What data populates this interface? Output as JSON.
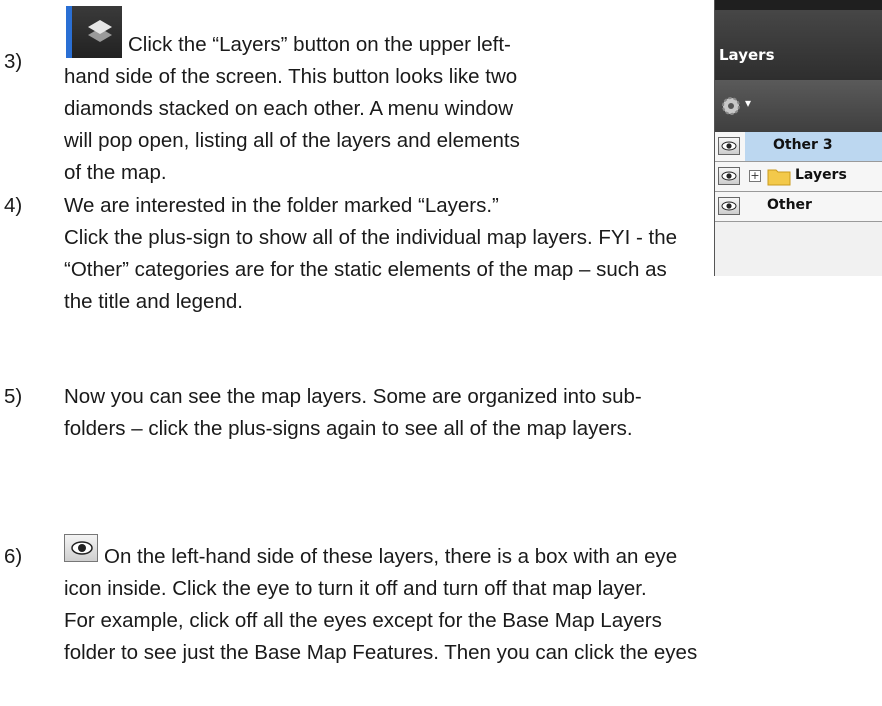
{
  "items": [
    {
      "number": "3)",
      "lines": [
        "Click the “Layers” button on the upper left-",
        "hand side of the screen. This button looks like two",
        "diamonds stacked on each other. A menu window",
        "will pop open, listing all of the layers and elements",
        "of the map."
      ]
    },
    {
      "number": "4)",
      "lines": [
        "We are interested in the folder marked “Layers.”",
        "Click the plus-sign to show all of the individual map layers. FYI - the",
        "“Other” categories are for the static elements of the map – such as",
        "the title and legend."
      ]
    },
    {
      "number": "5)",
      "lines": [
        "Now you can see the map layers. Some are organized into sub-",
        "folders – click the plus-signs again to see all of the map layers."
      ]
    },
    {
      "number": "6)",
      "lines": [
        "On the left-hand side of these layers, there is a box with an eye",
        "icon inside. Click the eye to turn it off and turn off that map layer.",
        "For example, click off all the eyes except for the Base Map Layers",
        "folder to see just the Base Map Features. Then you can click the eyes"
      ]
    }
  ],
  "panel": {
    "title": "Layers",
    "rows": [
      {
        "label": "Other 3",
        "selected": true,
        "has_plus": false,
        "has_folder": false
      },
      {
        "label": "Layers",
        "selected": false,
        "has_plus": true,
        "has_folder": true
      },
      {
        "label": "Other",
        "selected": false,
        "has_plus": false,
        "has_folder": false
      }
    ]
  },
  "icons": {
    "layers_button": "layers-icon",
    "eye": "eye-icon",
    "gear": "gear-icon",
    "folder": "folder-icon"
  },
  "colors": {
    "accent_blue": "#2a6fd4",
    "selected_row": "#bcd7f0",
    "panel_dark": "#333333"
  }
}
